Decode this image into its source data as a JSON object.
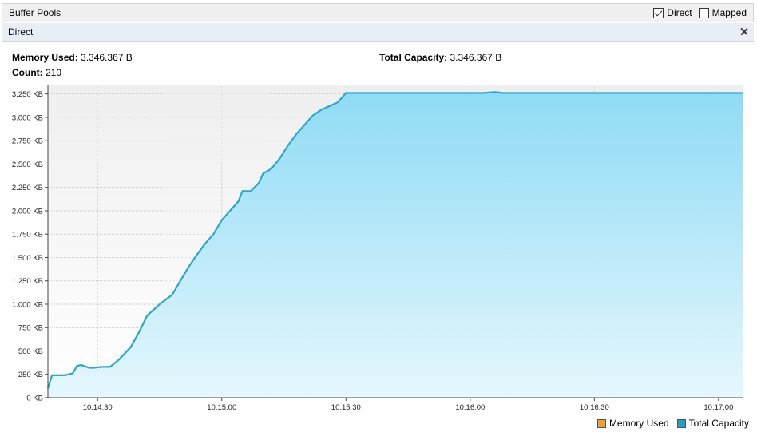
{
  "panel": {
    "title": "Buffer Pools",
    "checkboxes": [
      {
        "label": "Direct",
        "checked": true
      },
      {
        "label": "Mapped",
        "checked": false
      }
    ]
  },
  "tab": {
    "label": "Direct"
  },
  "stats": {
    "memory_used_label": "Memory Used:",
    "memory_used_value": "3.346.367 B",
    "total_capacity_label": "Total Capacity:",
    "total_capacity_value": "3.346.367 B",
    "count_label": "Count:",
    "count_value": "210"
  },
  "colors": {
    "memory_used": "#f0a030",
    "total_capacity": "#1e9fc8",
    "line": "#2ea9cc",
    "fill_top": "#8fdbf5",
    "fill_bottom": "#e6f7fd"
  },
  "chart_data": {
    "type": "area",
    "ylabel": "",
    "xlabel": "",
    "y_ticks": [
      "0 KB",
      "250 KB",
      "500 KB",
      "750 KB",
      "1.000 KB",
      "1.250 KB",
      "1.500 KB",
      "1.750 KB",
      "2.000 KB",
      "2.250 KB",
      "2.500 KB",
      "2.750 KB",
      "3.000 KB",
      "3.250 KB"
    ],
    "ylim": [
      0,
      3350
    ],
    "x_ticks": [
      "10:14:30",
      "10:15:00",
      "10:15:30",
      "10:16:00",
      "10:16:30",
      "10:17:00"
    ],
    "xlim": [
      "10:14:18",
      "10:17:06"
    ],
    "grid": true,
    "legend_position": "bottom-right",
    "series": [
      {
        "name": "Memory Used",
        "x": [
          "10:14:18",
          "10:14:19",
          "10:14:20",
          "10:14:22",
          "10:14:24",
          "10:14:25",
          "10:14:26",
          "10:14:28",
          "10:14:29",
          "10:14:31",
          "10:14:33",
          "10:14:35",
          "10:14:38",
          "10:14:40",
          "10:14:42",
          "10:14:45",
          "10:14:48",
          "10:14:50",
          "10:14:52",
          "10:14:54",
          "10:14:56",
          "10:14:58",
          "10:15:00",
          "10:15:02",
          "10:15:04",
          "10:15:05",
          "10:15:07",
          "10:15:09",
          "10:15:10",
          "10:15:12",
          "10:15:14",
          "10:15:16",
          "10:15:18",
          "10:15:20",
          "10:15:22",
          "10:15:24",
          "10:15:26",
          "10:15:28",
          "10:15:30",
          "10:15:31",
          "10:15:32",
          "10:15:40",
          "10:15:55",
          "10:16:03",
          "10:16:06",
          "10:16:08",
          "10:16:15",
          "10:17:06"
        ],
        "values": [
          100,
          240,
          240,
          240,
          260,
          340,
          350,
          320,
          320,
          330,
          330,
          400,
          540,
          700,
          880,
          1000,
          1100,
          1250,
          1400,
          1530,
          1650,
          1750,
          1900,
          2000,
          2100,
          2210,
          2210,
          2300,
          2400,
          2450,
          2560,
          2700,
          2820,
          2920,
          3020,
          3080,
          3120,
          3160,
          3260,
          3260,
          3260,
          3260,
          3260,
          3260,
          3270,
          3260,
          3260,
          3260
        ]
      },
      {
        "name": "Total Capacity",
        "x": [
          "10:14:18",
          "10:14:19",
          "10:14:20",
          "10:14:22",
          "10:14:24",
          "10:14:25",
          "10:14:26",
          "10:14:28",
          "10:14:29",
          "10:14:31",
          "10:14:33",
          "10:14:35",
          "10:14:38",
          "10:14:40",
          "10:14:42",
          "10:14:45",
          "10:14:48",
          "10:14:50",
          "10:14:52",
          "10:14:54",
          "10:14:56",
          "10:14:58",
          "10:15:00",
          "10:15:02",
          "10:15:04",
          "10:15:05",
          "10:15:07",
          "10:15:09",
          "10:15:10",
          "10:15:12",
          "10:15:14",
          "10:15:16",
          "10:15:18",
          "10:15:20",
          "10:15:22",
          "10:15:24",
          "10:15:26",
          "10:15:28",
          "10:15:30",
          "10:15:31",
          "10:15:32",
          "10:15:40",
          "10:15:55",
          "10:16:03",
          "10:16:06",
          "10:16:08",
          "10:16:15",
          "10:17:06"
        ],
        "values": [
          100,
          240,
          240,
          240,
          260,
          340,
          350,
          320,
          320,
          330,
          330,
          400,
          540,
          700,
          880,
          1000,
          1100,
          1250,
          1400,
          1530,
          1650,
          1750,
          1900,
          2000,
          2100,
          2210,
          2210,
          2300,
          2400,
          2450,
          2560,
          2700,
          2820,
          2920,
          3020,
          3080,
          3120,
          3160,
          3260,
          3260,
          3260,
          3260,
          3260,
          3260,
          3270,
          3260,
          3260,
          3260
        ]
      }
    ]
  },
  "legend": [
    {
      "label": "Memory Used",
      "color": "#f0a030"
    },
    {
      "label": "Total Capacity",
      "color": "#1e9fc8"
    }
  ]
}
